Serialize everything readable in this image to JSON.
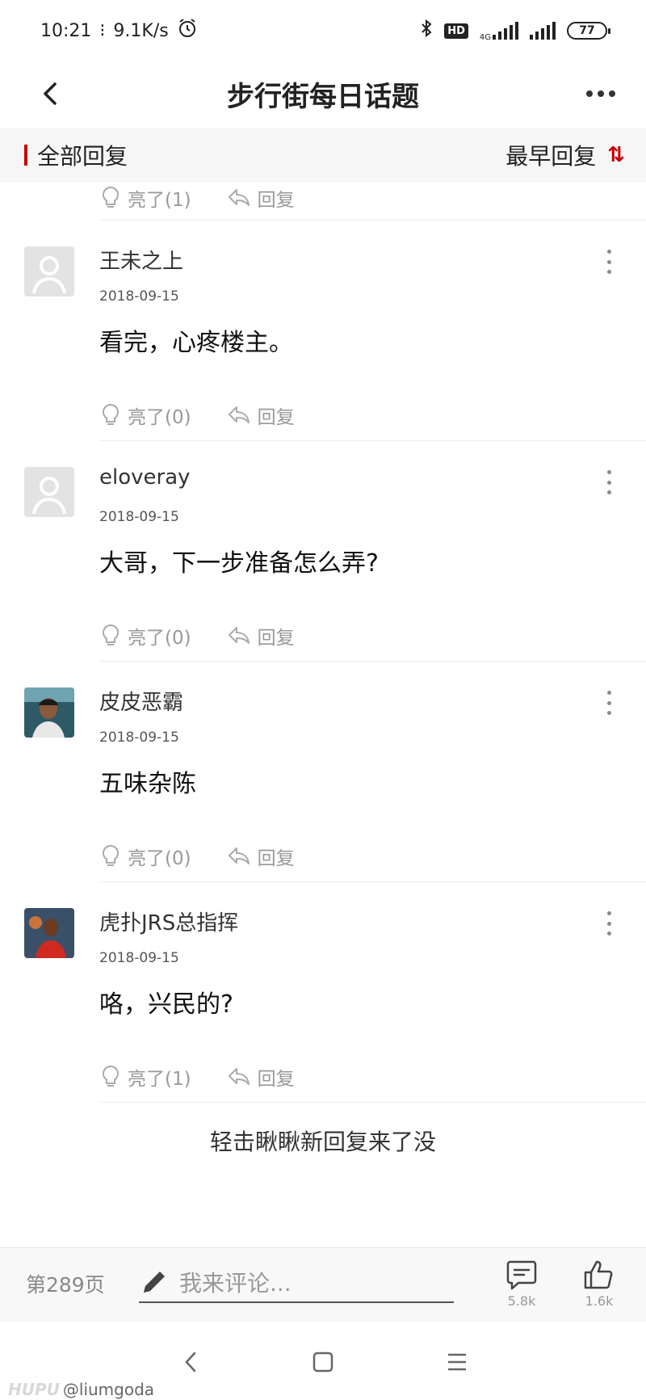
{
  "status_bar": {
    "time": "10:21",
    "speed": "9.1K/s",
    "hd": "HD",
    "network": "4G",
    "battery": "77"
  },
  "header": {
    "title": "步行街每日话题"
  },
  "filter": {
    "all_replies": "全部回复",
    "sort_label": "最早回复",
    "sort_icon": "⇅"
  },
  "top_actions": {
    "light_label": "亮了(1)",
    "reply_label": "回复"
  },
  "posts": [
    {
      "author": "王未之上",
      "date": "2018-09-15",
      "content": "看完，心疼楼主。",
      "light_label": "亮了(0)",
      "reply_label": "回复",
      "avatar": "default"
    },
    {
      "author": "eloveray",
      "date": "2018-09-15",
      "content": "大哥，下一步准备怎么弄?",
      "light_label": "亮了(0)",
      "reply_label": "回复",
      "avatar": "default"
    },
    {
      "author": "皮皮恶霸",
      "date": "2018-09-15",
      "content": "五味杂陈",
      "light_label": "亮了(0)",
      "reply_label": "回复",
      "avatar": "photo"
    },
    {
      "author": "虎扑JRS总指挥",
      "date": "2018-09-15",
      "content": "咯，兴民的?",
      "light_label": "亮了(1)",
      "reply_label": "回复",
      "avatar": "photo"
    }
  ],
  "refresh_text": "轻击瞅瞅新回复来了没",
  "bottom_bar": {
    "page": "第289页",
    "comment_placeholder": "我来评论...",
    "comment_count": "5.8k",
    "like_count": "1.6k"
  },
  "watermark": {
    "logo": "HUPU",
    "handle": "@liumgoda"
  },
  "colors": {
    "accent": "#c60100",
    "muted": "#999999",
    "filter_bg": "#f6f6f6"
  }
}
